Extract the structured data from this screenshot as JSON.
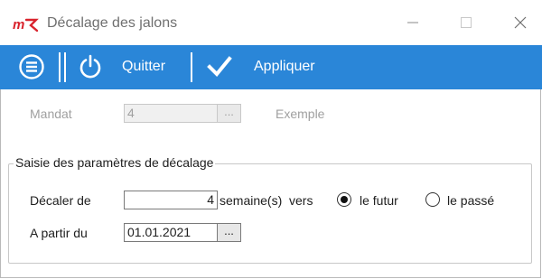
{
  "window": {
    "title": "Décalage des jalons",
    "logo_text": "mk",
    "controls": [
      "minimize",
      "maximize",
      "close"
    ]
  },
  "toolbar": {
    "background": "#2a86d8",
    "menu_icon": "menu-lines-icon",
    "quit_icon": "power-icon",
    "quit_label": "Quitter",
    "apply_icon": "checkmark-icon",
    "apply_label": "Appliquer"
  },
  "mandat": {
    "label": "Mandat",
    "value": "4",
    "browse": "...",
    "example_label": "Exemple"
  },
  "group": {
    "title": "Saisie des paramètres de décalage",
    "shift": {
      "label": "Décaler de",
      "value": "4",
      "unit_text": "semaine(s)  vers",
      "options": [
        {
          "label": "le futur",
          "selected": true
        },
        {
          "label": "le passé",
          "selected": false
        }
      ]
    },
    "start": {
      "label": "A partir du",
      "value": "01.01.2021",
      "browse": "..."
    }
  }
}
